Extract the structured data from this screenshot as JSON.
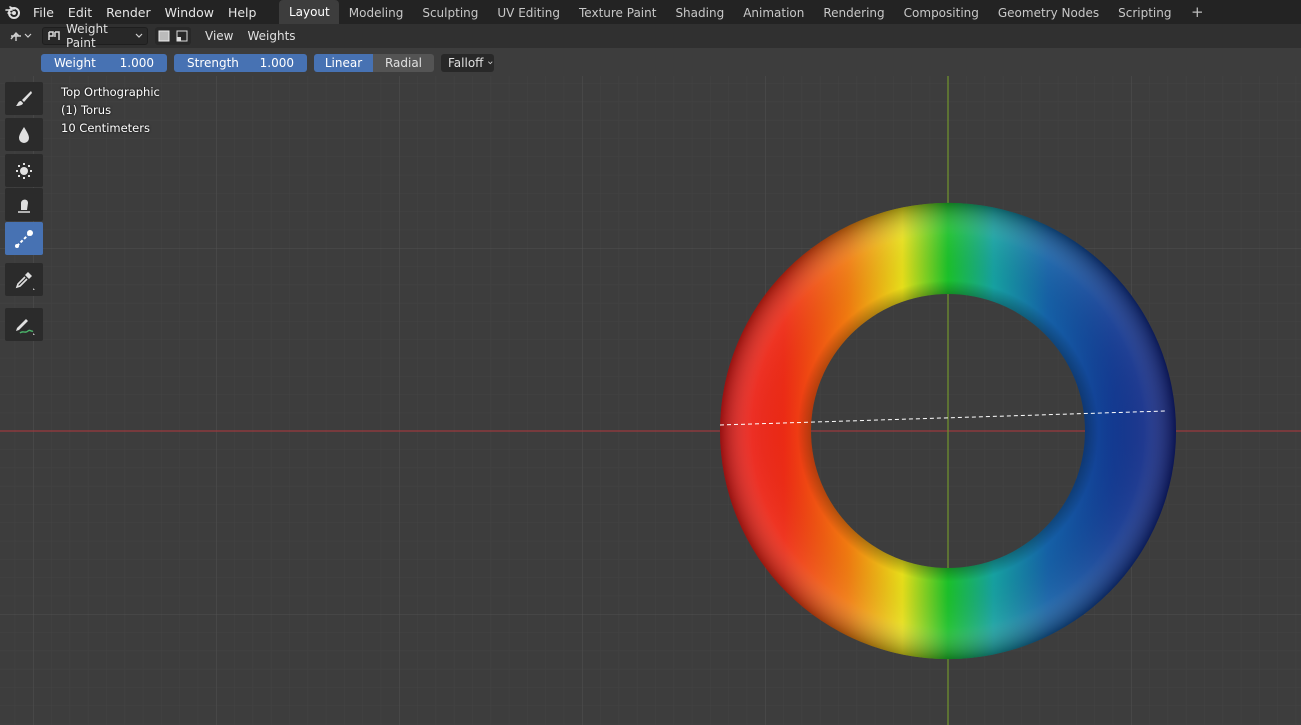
{
  "menu": {
    "items": [
      "File",
      "Edit",
      "Render",
      "Window",
      "Help"
    ]
  },
  "workspaces": {
    "tabs": [
      "Layout",
      "Modeling",
      "Sculpting",
      "UV Editing",
      "Texture Paint",
      "Shading",
      "Animation",
      "Rendering",
      "Compositing",
      "Geometry Nodes",
      "Scripting"
    ],
    "active": "Layout",
    "add_label": "+"
  },
  "header": {
    "mode": "Weight Paint",
    "view_menu": "View",
    "weights_menu": "Weights"
  },
  "tool_settings": {
    "weight_label": "Weight",
    "weight_value": "1.000",
    "strength_label": "Strength",
    "strength_value": "1.000",
    "linear_label": "Linear",
    "radial_label": "Radial",
    "falloff_label": "Falloff"
  },
  "viewport": {
    "view_name": "Top Orthographic",
    "object_name": "(1) Torus",
    "scale": "10 Centimeters"
  },
  "toolbar": {
    "tools": [
      "draw-tool-icon",
      "blur-tool-icon",
      "average-tool-icon",
      "smear-tool-icon",
      "gradient-tool-icon",
      "sample-weight-tool-icon",
      "annotate-tool-icon"
    ],
    "active_tool": "gradient-tool-icon"
  },
  "colors": {
    "accent": "#4772b3",
    "x_axis": "#a5343f",
    "y_axis": "#6b8f2a",
    "background": "#3d3d3d"
  }
}
